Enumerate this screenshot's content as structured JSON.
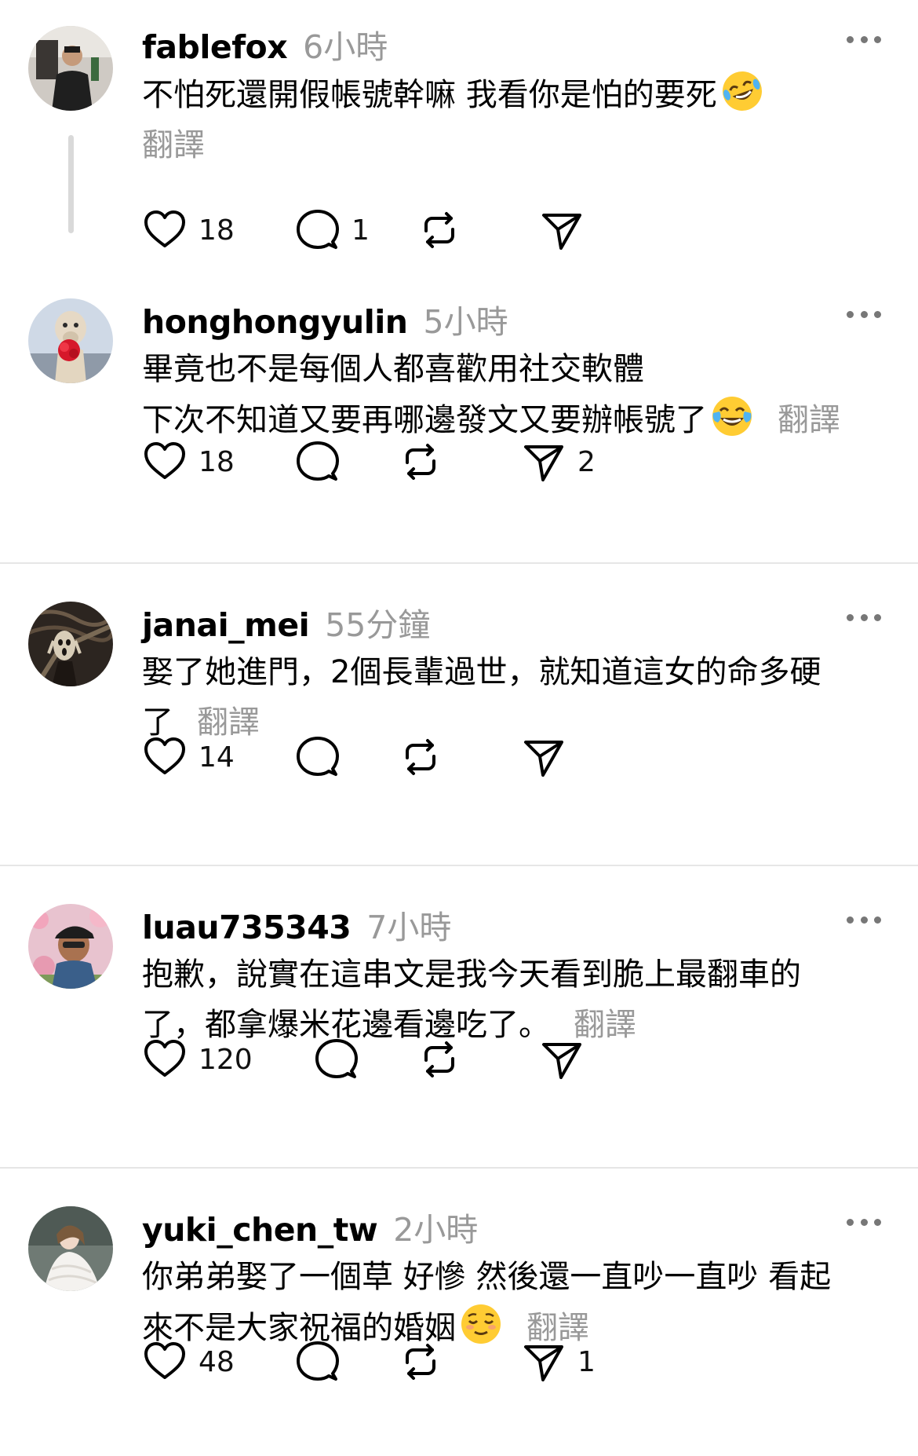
{
  "comments": [
    {
      "username": "fablefox",
      "time": "6小時",
      "lines": [
        "不怕死還開假帳號幹嘛 我看你是怕的要死"
      ],
      "emoji": "rolling-laughing-emoji",
      "translate": "翻譯",
      "likes": "18",
      "replies": "1",
      "reposts": "",
      "shares": ""
    },
    {
      "username": "honghongyulin",
      "time": "5小時",
      "lines": [
        "畢竟也不是每個人都喜歡用社交軟體",
        "下次不知道又要再哪邊發文又要辦帳號了"
      ],
      "emoji": "tears-of-joy-emoji",
      "translate": "翻譯",
      "likes": "18",
      "replies": "",
      "reposts": "",
      "shares": "2"
    },
    {
      "username": "janai_mei",
      "time": "55分鐘",
      "lines": [
        "娶了她進門，2個長輩過世，就知道這女的命多硬",
        "了"
      ],
      "translate": "翻譯",
      "likes": "14",
      "replies": "",
      "reposts": "",
      "shares": ""
    },
    {
      "username": "luau735343",
      "time": "7小時",
      "lines": [
        "抱歉，說實在這串文是我今天看到脆上最翻車的",
        "了，都拿爆米花邊看邊吃了。"
      ],
      "translate": "翻譯",
      "likes": "120",
      "replies": "",
      "reposts": "",
      "shares": ""
    },
    {
      "username": "yuki_chen_tw",
      "time": "2小時",
      "lines": [
        "你弟弟娶了一個草 好慘 然後還一直吵一直吵 看起",
        "來不是大家祝福的婚姻"
      ],
      "emoji": "relieved-face-emoji",
      "translate": "翻譯",
      "likes": "48",
      "replies": "",
      "reposts": "",
      "shares": "1"
    }
  ],
  "colors": {
    "text": "#000000",
    "muted": "#999999",
    "divider": "#e6e6e6",
    "thread_line": "#d9d9d9",
    "emoji_yellow": "#ffcc33"
  },
  "icons": [
    "heart-icon",
    "comment-icon",
    "repost-icon",
    "share-icon",
    "more-icon"
  ]
}
